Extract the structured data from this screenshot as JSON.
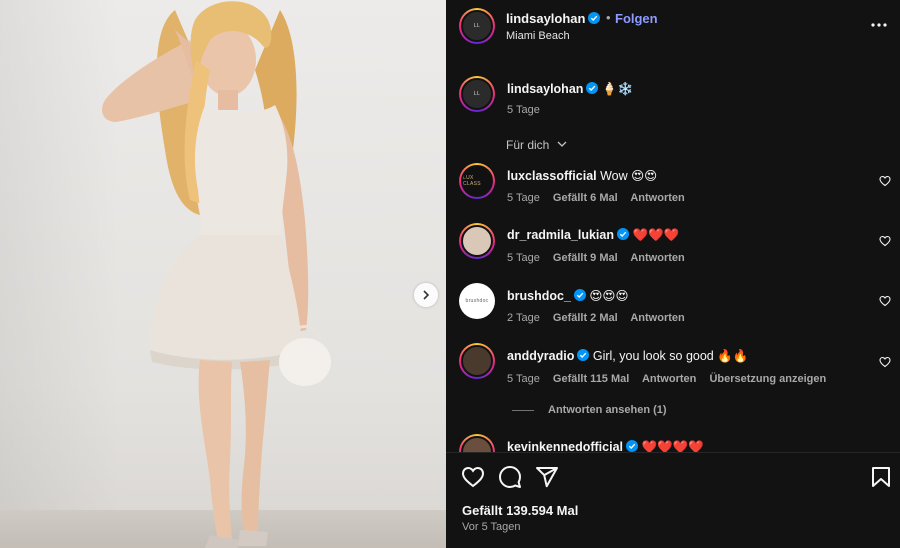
{
  "post": {
    "username": "lindsaylohan",
    "location": "Miami Beach",
    "follow_label": "Folgen",
    "dot": "•",
    "caption_emoji": "🍦❄️",
    "caption_time": "5 Tage",
    "avatar_label": "LL"
  },
  "comments_header": {
    "sort_label": "Für dich"
  },
  "comments": [
    {
      "username": "luxclassofficial",
      "text": "Wow 😍😍",
      "time": "5 Tage",
      "likes": "Gefällt 6 Mal",
      "reply": "Antworten",
      "avatar_label": "LUX CLASS",
      "verified": false
    },
    {
      "username": "dr_radmila_lukian",
      "text": "❤️❤️❤️",
      "time": "5 Tage",
      "likes": "Gefällt 9 Mal",
      "reply": "Antworten",
      "avatar_label": "",
      "verified": true
    },
    {
      "username": "brushdoc_",
      "text": "😍😍😍",
      "time": "2 Tage",
      "likes": "Gefällt 2 Mal",
      "reply": "Antworten",
      "avatar_label": "brushdoc",
      "verified": true
    },
    {
      "username": "anddyradio",
      "text": "Girl, you look so good 🔥🔥",
      "time": "5 Tage",
      "likes": "Gefällt 115 Mal",
      "reply": "Antworten",
      "translate": "Übersetzung anzeigen",
      "avatar_label": "",
      "verified": true
    },
    {
      "username": "kevinkennedofficial",
      "text": "❤️❤️❤️❤️",
      "avatar_label": "",
      "verified": true
    }
  ],
  "view_replies": "Antworten ansehen (1)",
  "footer": {
    "likes": "Gefällt 139.594 Mal",
    "ago": "Vor 5 Tagen"
  },
  "colors": {
    "panel_bg": "#121212",
    "follow": "#8e9bff",
    "verified": "#0095f6",
    "muted": "#a8a8a8"
  },
  "icons": [
    "chevron-right-icon",
    "more-icon",
    "verified-icon",
    "heart-icon",
    "comment-icon",
    "share-icon",
    "bookmark-icon",
    "chevron-down-icon"
  ]
}
